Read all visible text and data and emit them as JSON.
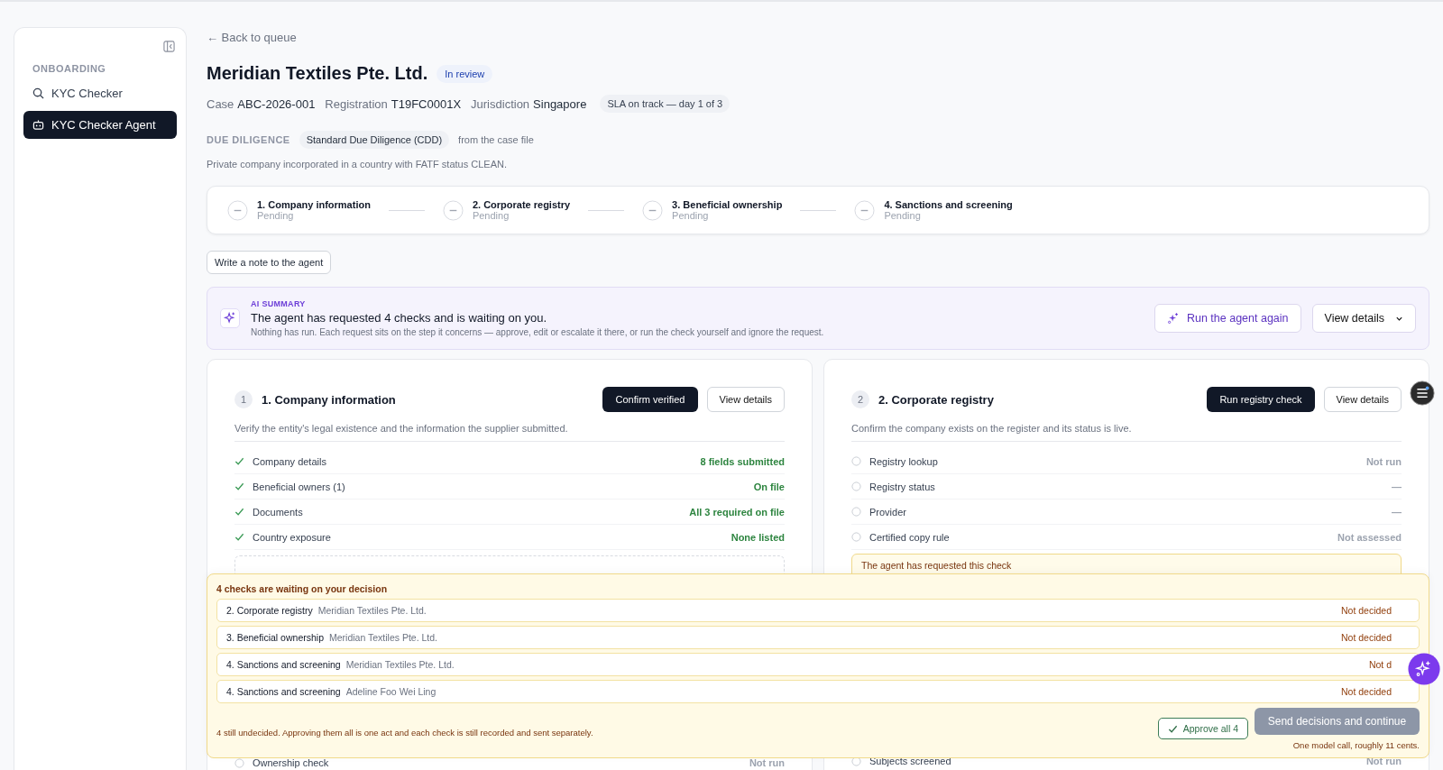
{
  "sidebar": {
    "section": "ONBOARDING",
    "items": [
      {
        "label": "KYC Checker",
        "kind": "search",
        "selected": false
      },
      {
        "label": "KYC Checker Agent",
        "kind": "robot",
        "selected": true
      }
    ]
  },
  "back_link": "← Back to queue",
  "title": "Meridian Textiles Pte. Ltd.",
  "status_badge": "In review",
  "meta": [
    {
      "label": "Case",
      "value": "ABC-2026-001"
    },
    {
      "label": "Registration",
      "value": "T19FC0001X"
    },
    {
      "label": "Jurisdiction",
      "value": "Singapore"
    }
  ],
  "sla": "SLA on track — day 1 of 3",
  "due_diligence": {
    "label": "DUE DILIGENCE",
    "tag": "Standard Due Diligence (CDD)",
    "source": "from the case file",
    "description": "Private company incorporated in a country with FATF status CLEAN."
  },
  "steps": [
    {
      "title": "1. Company information",
      "status": "Pending"
    },
    {
      "title": "2. Corporate registry",
      "status": "Pending"
    },
    {
      "title": "3. Beneficial ownership",
      "status": "Pending"
    },
    {
      "title": "4. Sanctions and screening",
      "status": "Pending"
    }
  ],
  "note_button": "Write a note to the agent",
  "ai_summary": {
    "label": "AI SUMMARY",
    "headline": "The agent has requested 4 checks and is waiting on you.",
    "body": "Nothing has run. Each request sits on the step it concerns — approve, edit or escalate it there, or run the check yourself and ignore the request.",
    "rerun": "Run the agent again",
    "details": "View details"
  },
  "cards": [
    {
      "number": "1",
      "title": "1. Company information",
      "primary": "Confirm verified",
      "secondary": "View details",
      "description": "Verify the entity's legal existence and the information the supplier submitted.",
      "rows": [
        {
          "label": "Company details",
          "value": "8 fields submitted",
          "kind": "done"
        },
        {
          "label": "Beneficial owners (1)",
          "value": "On file",
          "kind": "done"
        },
        {
          "label": "Documents",
          "value": "All 3 required on file",
          "kind": "done"
        },
        {
          "label": "Country exposure",
          "value": "None listed",
          "kind": "done"
        }
      ],
      "box": {
        "kind": "dashed"
      },
      "lower_row": {
        "label": "Ownership check",
        "value": "Not run",
        "kind": "pending"
      }
    },
    {
      "number": "2",
      "title": "2. Corporate registry",
      "primary": "Run registry check",
      "secondary": "View details",
      "description": "Confirm the company exists on the register and its status is live.",
      "rows": [
        {
          "label": "Registry lookup",
          "value": "Not run",
          "kind": "pending"
        },
        {
          "label": "Registry status",
          "value": "—",
          "kind": "pending"
        },
        {
          "label": "Provider",
          "value": "—",
          "kind": "pending"
        },
        {
          "label": "Certified copy rule",
          "value": "Not assessed",
          "kind": "pending"
        }
      ],
      "box": {
        "kind": "request",
        "text": "The agent has requested this check"
      },
      "lower_row": {
        "label": "Subjects screened",
        "value": "Not run",
        "kind": "pending"
      }
    }
  ],
  "decisions": {
    "title": "4 checks are waiting on your decision",
    "items": [
      {
        "step": "2. Corporate registry",
        "subject": "Meridian Textiles Pte. Ltd.",
        "status": "Not decided"
      },
      {
        "step": "3. Beneficial ownership",
        "subject": "Meridian Textiles Pte. Ltd.",
        "status": "Not decided"
      },
      {
        "step": "4. Sanctions and screening",
        "subject": "Meridian Textiles Pte. Ltd.",
        "status": "Not d"
      },
      {
        "step": "4. Sanctions and screening",
        "subject": "Adeline Foo Wei Ling",
        "status": "Not decided"
      }
    ],
    "footnote": "4 still undecided. Approving them all is one act and each check is still recorded and sent separately.",
    "approve": "Approve all 4",
    "send": {
      "label": "Send decisions and continue",
      "disabled": true
    },
    "cost": "One model call, roughly 11 cents."
  }
}
